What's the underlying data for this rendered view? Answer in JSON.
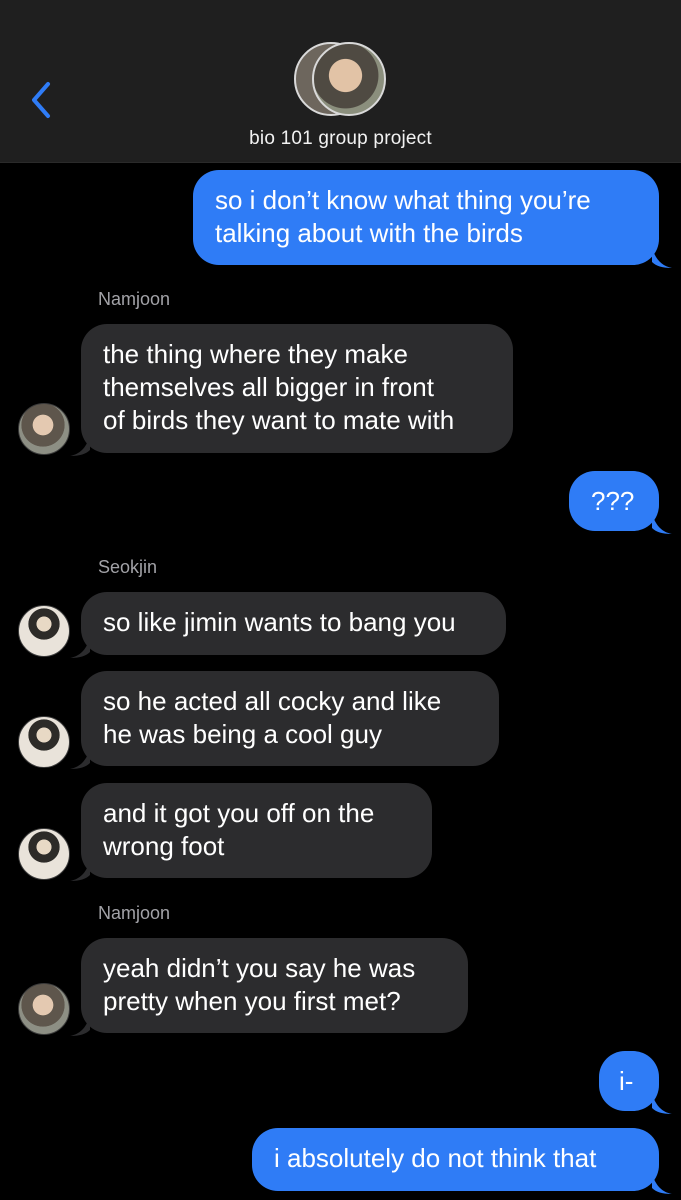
{
  "header": {
    "title": "bio 101 group project",
    "back_icon": "chevron-left-icon"
  },
  "colors": {
    "outgoing_bubble": "#2f7cf6",
    "incoming_bubble": "#2c2c2e",
    "accent": "#2f7cf6"
  },
  "senders": {
    "namjoon": "Namjoon",
    "seokjin": "Seokjin"
  },
  "messages": [
    {
      "direction": "out",
      "lines": [
        "so i don’t know what thing you’re",
        "talking about with the birds"
      ]
    },
    {
      "direction": "in",
      "sender": "Namjoon",
      "lines": [
        "the thing where they make",
        "themselves all bigger in front",
        "of birds they want to mate with"
      ]
    },
    {
      "direction": "out",
      "lines": [
        "???"
      ]
    },
    {
      "direction": "in",
      "sender": "Seokjin",
      "lines": [
        "so like jimin wants to bang you"
      ]
    },
    {
      "direction": "in",
      "sender": "Seokjin",
      "lines": [
        "so he acted all cocky and like",
        "he was being a cool guy"
      ]
    },
    {
      "direction": "in",
      "sender": "Seokjin",
      "lines": [
        "and it got you off on the",
        "wrong foot"
      ]
    },
    {
      "direction": "in",
      "sender": "Namjoon",
      "lines": [
        "yeah didn’t you say he was",
        "pretty when you first met?"
      ]
    },
    {
      "direction": "out",
      "lines": [
        "i-"
      ]
    },
    {
      "direction": "out",
      "lines": [
        "i absolutely do not think that"
      ]
    }
  ]
}
